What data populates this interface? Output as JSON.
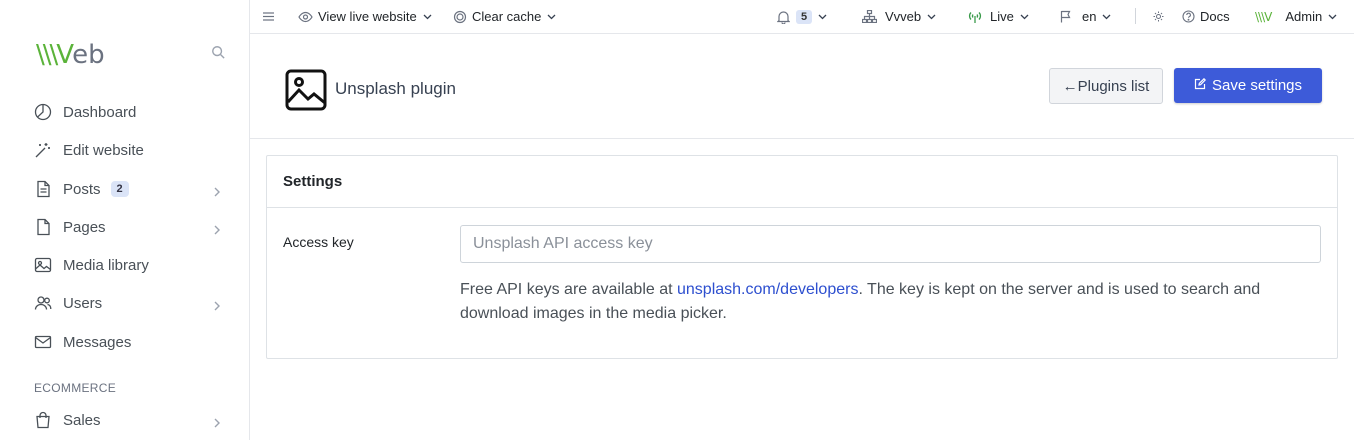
{
  "sidebar": {
    "logo_left": "\\\\\\V",
    "logo_right": "eb",
    "items": [
      {
        "label": "Dashboard"
      },
      {
        "label": "Edit website"
      },
      {
        "label": "Posts",
        "badge": "2"
      },
      {
        "label": "Pages"
      },
      {
        "label": "Media library"
      },
      {
        "label": "Users"
      },
      {
        "label": "Messages"
      }
    ],
    "section_ecommerce": "ECOMMERCE",
    "sales": {
      "label": "Sales"
    }
  },
  "topbar": {
    "view_live": "View live website",
    "clear_cache": "Clear cache",
    "notifications_count": "5",
    "site": "Vvveb",
    "status": "Live",
    "language": "en",
    "docs": "Docs",
    "user": "Admin"
  },
  "page": {
    "title": "Unsplash plugin",
    "back_button": "Plugins list",
    "save_button": "Save settings"
  },
  "settings": {
    "header": "Settings",
    "access_key": {
      "label": "Access key",
      "value": "",
      "placeholder": "Unsplash API access key"
    },
    "help_before": "Free API keys are available at ",
    "help_link": "unsplash.com/developers",
    "help_after": ". The key is kept on the server and is used to search and download images in the media picker."
  },
  "colors": {
    "accent": "#3d5bd9",
    "logo_green": "#5bb33a",
    "link": "#2d4fcf"
  }
}
